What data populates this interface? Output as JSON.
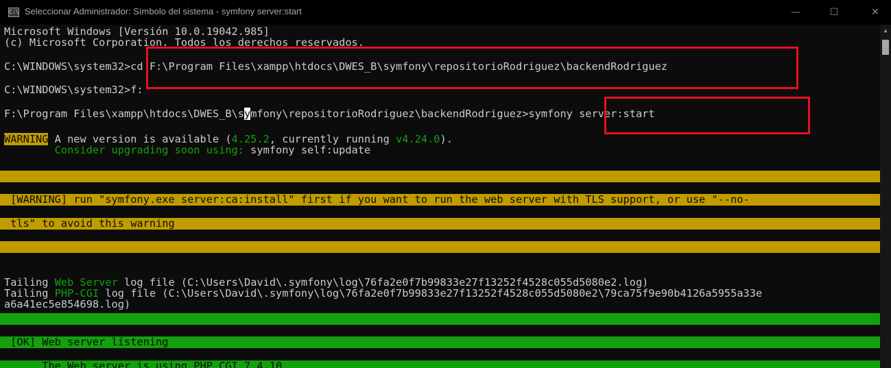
{
  "window": {
    "title": "Seleccionar Administrador: Símbolo del sistema - symfony  server:start",
    "icon_label": "C:\\",
    "minimize_icon": "—",
    "maximize_icon": "☐",
    "close_icon": "✕"
  },
  "colors": {
    "background": "#0c0c0c",
    "text": "#cccccc",
    "yellow": "#c19c00",
    "green": "#13a10e",
    "highlight_box": "#e8111e"
  },
  "console": {
    "header1": "Microsoft Windows [Versión 10.0.19042.985]",
    "header2": "(c) Microsoft Corporation. Todos los derechos reservados.",
    "prompt1": "C:\\WINDOWS\\system32>",
    "cmd1": "cd F:\\Program Files\\xampp\\htdocs\\DWES_B\\symfony\\repositorioRodriguez\\backendRodriguez",
    "prompt2": "C:\\WINDOWS\\system32>",
    "cmd2": "f:",
    "prompt3_a": "F:\\Program Files\\xampp\\htdocs\\DWES_B\\s",
    "prompt3_cursor": "y",
    "prompt3_b": "mfony\\repositorioRodriguez\\backendRodriguez>",
    "cmd3": "symfony server:start",
    "warn_tag": "WARNING",
    "warn_a": " A new version is available (",
    "warn_new": "4.25.2",
    "warn_b": ", currently running ",
    "warn_cur": "v4.24.0",
    "warn_c": ").",
    "upgrade_a": "        Consider upgrading soon using: ",
    "upgrade_b": "symfony self:update",
    "tls1": " [WARNING] run \"symfony.exe server:ca:install\" first if you want to run the web server with TLS support, or use \"--no-",
    "tls2": " tls\" to avoid this warning",
    "tail1_a": "Tailing ",
    "tail1_hl": "Web Server",
    "tail1_b": " log file (C:\\Users\\David\\.symfony\\log\\76fa2e0f7b99833e27f13252f4528c055d5080e2.log)",
    "tail2_a": "Tailing ",
    "tail2_hl": "PHP-CGI",
    "tail2_b": " log file (C:\\Users\\David\\.symfony\\log\\76fa2e0f7b99833e27f13252f4528c055d5080e2\\79ca75f9e90b4126a5955a33e",
    "tail3": "a6a41ec5e854698.log)",
    "ok1": " [OK] Web server listening",
    "ok2": "      The Web server is using PHP CGI 7.4.10"
  }
}
